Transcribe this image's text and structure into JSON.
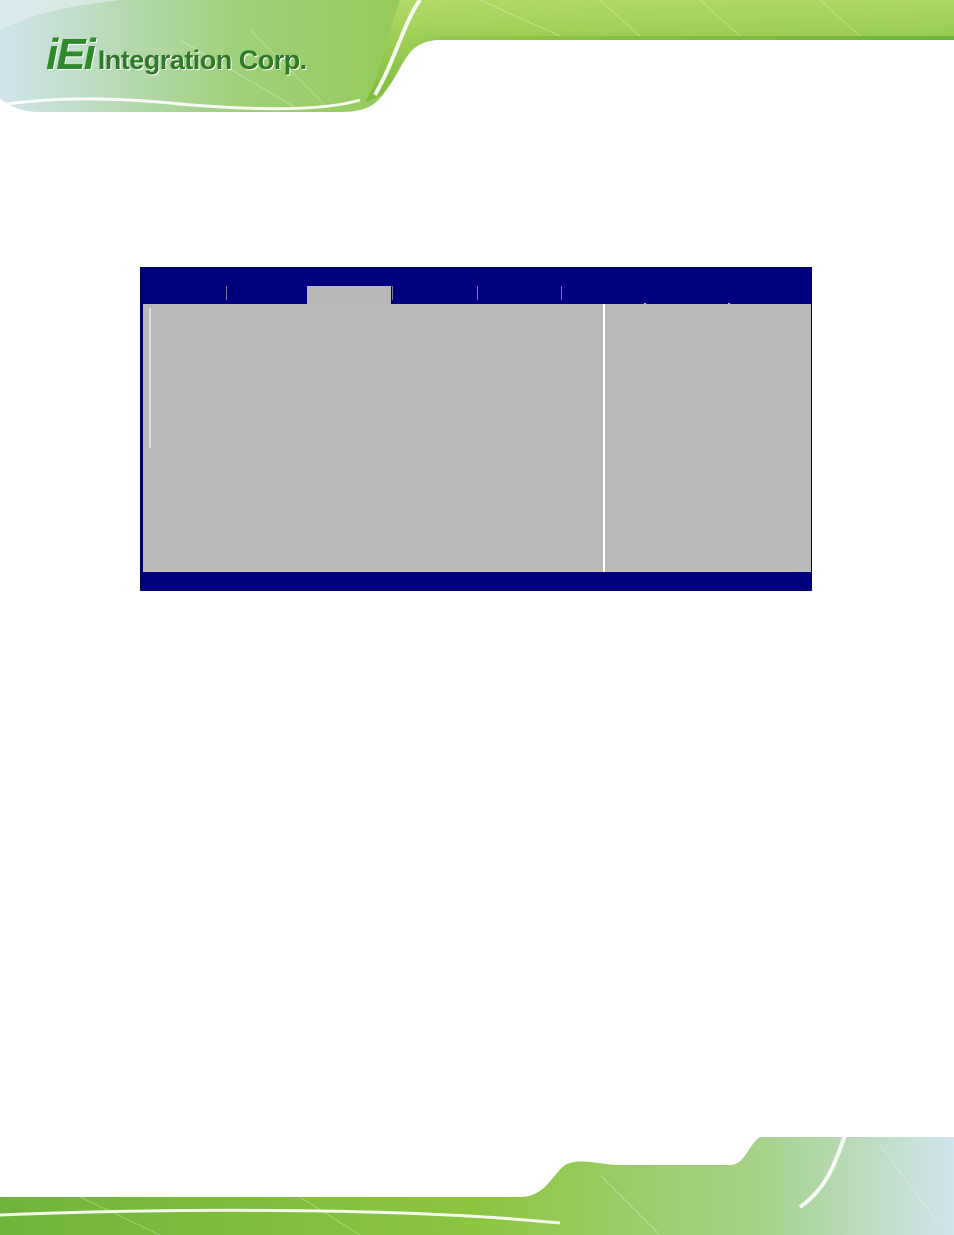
{
  "header": {
    "logo_mark": "iEi",
    "logo_text": "Integration Corp.",
    "colors": {
      "banner_green": "#7fc241",
      "logo_green": "#2f8a2c",
      "logo_dot": "#1c3d9e"
    }
  },
  "bios": {
    "colors": {
      "frame": "#00007e",
      "panel": "#b9b9b9",
      "active_tab": "#b8b8b8"
    },
    "tabs": [
      {
        "label": ""
      },
      {
        "label": ""
      },
      {
        "label": ""
      },
      {
        "label": ""
      },
      {
        "label": ""
      }
    ],
    "active_tab_index": 2
  }
}
